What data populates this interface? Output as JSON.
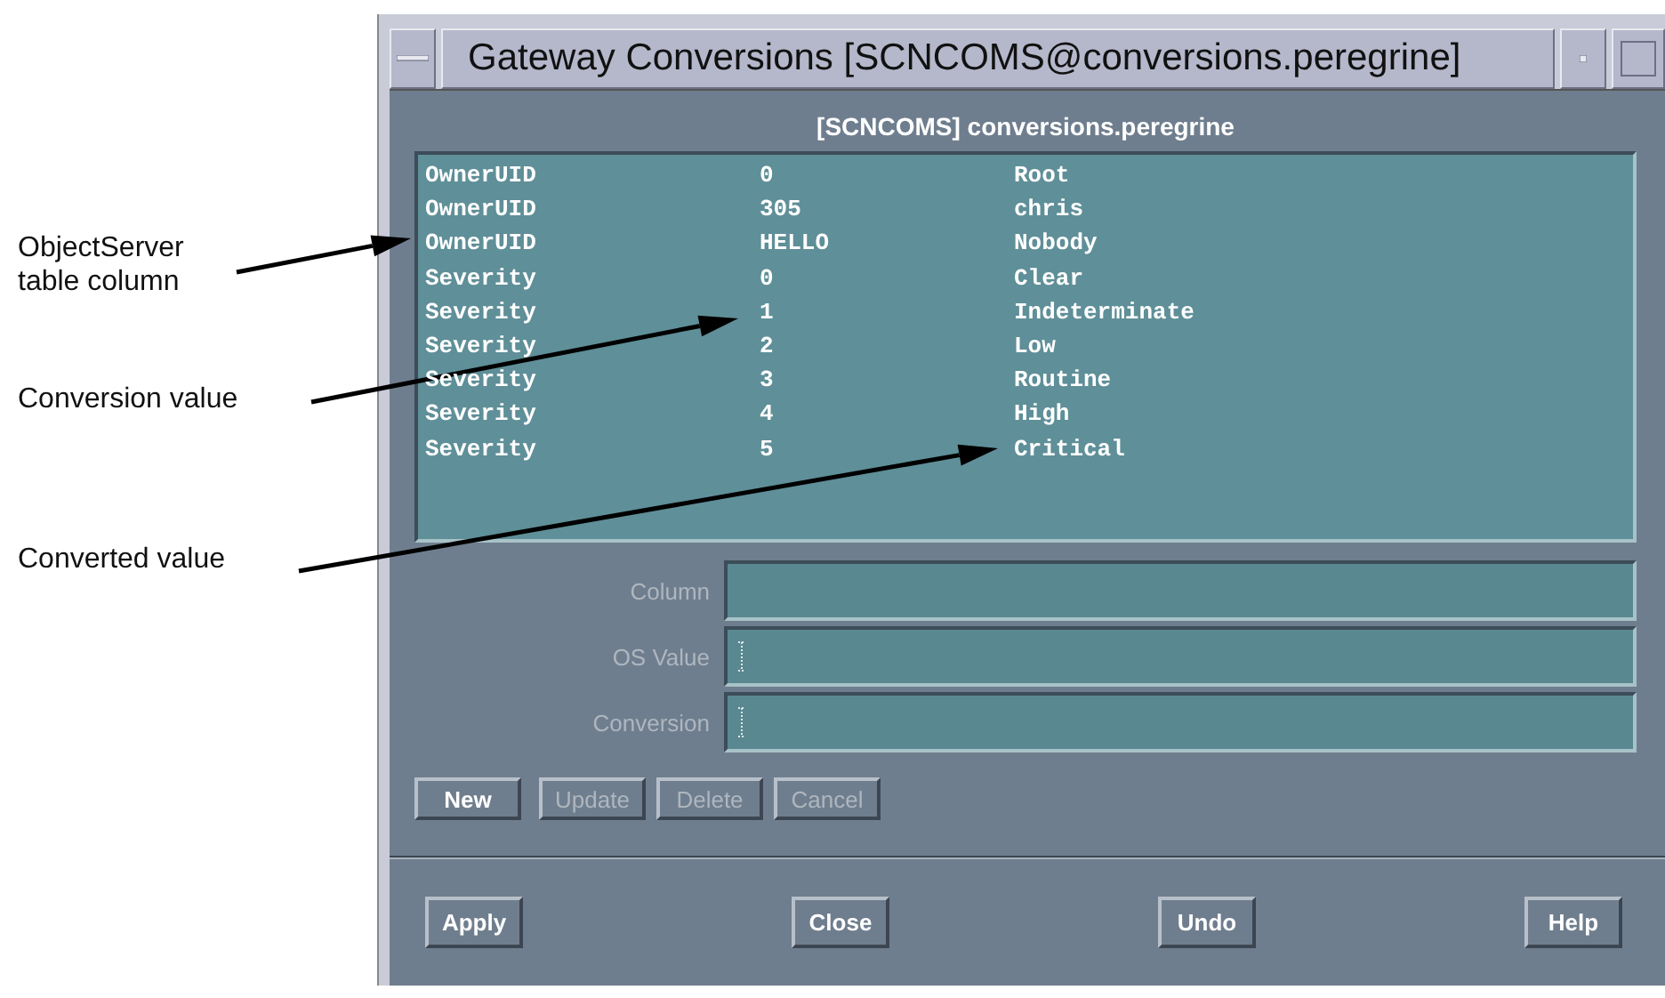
{
  "window": {
    "title": "Gateway Conversions [SCNCOMS@conversions.peregrine]"
  },
  "header": "[SCNCOMS] conversions.peregrine",
  "conversions": {
    "rows": [
      {
        "cells": [
          "OwnerUID",
          "0",
          "Root"
        ]
      },
      {
        "cells": [
          "OwnerUID",
          "305",
          "chris"
        ]
      },
      {
        "cells": [
          "OwnerUID",
          "HELLO",
          "Nobody"
        ]
      },
      {
        "cells": [
          "Severity",
          "0",
          "Clear"
        ]
      },
      {
        "cells": [
          "Severity",
          "1",
          "Indeterminate"
        ]
      },
      {
        "cells": [
          "Severity",
          "2",
          "Low"
        ]
      },
      {
        "cells": [
          "Severity",
          "3",
          "Routine"
        ]
      },
      {
        "cells": [
          "Severity",
          "4",
          "High"
        ]
      },
      {
        "cells": [
          "Severity",
          "5",
          "Critical"
        ]
      }
    ]
  },
  "fields": [
    {
      "label": "Column",
      "disabled": true,
      "cursor": false
    },
    {
      "label": "OS Value",
      "disabled": true,
      "cursor": true
    },
    {
      "label": "Conversion",
      "disabled": true,
      "cursor": true
    }
  ],
  "edit_buttons": [
    {
      "label": "New",
      "disabled": false
    },
    {
      "label": "Update",
      "disabled": true
    },
    {
      "label": "Delete",
      "disabled": true
    },
    {
      "label": "Cancel",
      "disabled": true
    }
  ],
  "dialog_buttons": [
    "Apply",
    "Close",
    "Undo",
    "Help"
  ],
  "callouts": [
    {
      "text": "ObjectServer table column"
    },
    {
      "text": "Conversion value"
    },
    {
      "text": "Converted value"
    }
  ]
}
